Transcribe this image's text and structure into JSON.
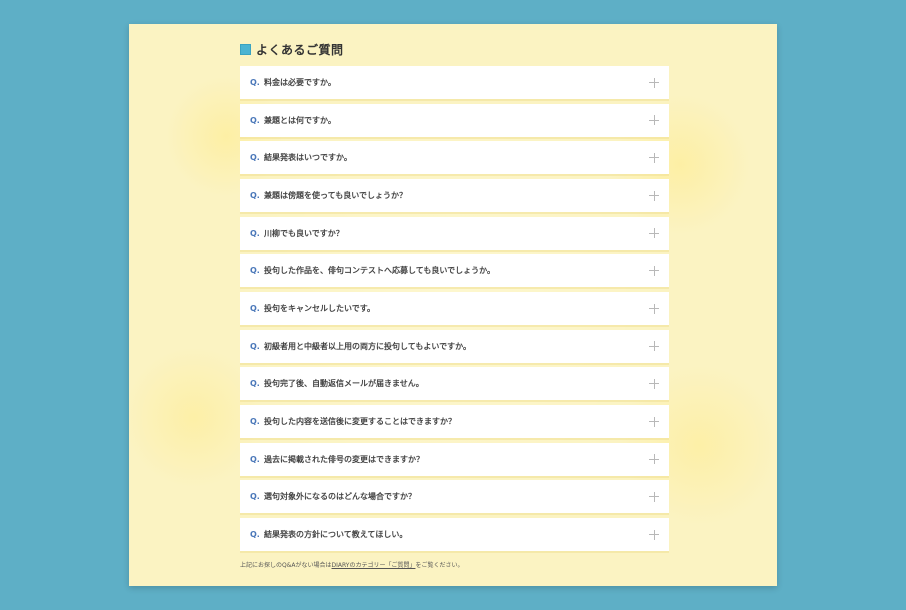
{
  "faq": {
    "title": "よくあるご質問",
    "q_prefix": "Q.",
    "items": [
      {
        "question": "料金は必要ですか。"
      },
      {
        "question": "兼題とは何ですか。"
      },
      {
        "question": "結果発表はいつですか。"
      },
      {
        "question": "兼題は傍題を使っても良いでしょうか？"
      },
      {
        "question": "川柳でも良いですか？"
      },
      {
        "question": "投句した作品を、俳句コンテストへ応募しても良いでしょうか。"
      },
      {
        "question": "投句をキャンセルしたいです。"
      },
      {
        "question": "初級者用と中級者以上用の両方に投句してもよいですか。"
      },
      {
        "question": "投句完了後、自動返信メールが届きません。"
      },
      {
        "question": "投句した内容を送信後に変更することはできますか？"
      },
      {
        "question": "過去に掲載された俳号の変更はできますか？"
      },
      {
        "question": "選句対象外になるのはどんな場合ですか？"
      },
      {
        "question": "結果発表の方針について教えてほしい。"
      }
    ],
    "footnote": {
      "before": "上記にお探しのQ&Aがない場合は",
      "link": "DIARYのカテゴリー「ご質問」",
      "after": "をご覧ください。"
    }
  },
  "colors": {
    "background": "#5eafc6",
    "paper": "#fbf3c2",
    "accent": "#4bb4d2",
    "q_mark": "#4b78b9"
  }
}
